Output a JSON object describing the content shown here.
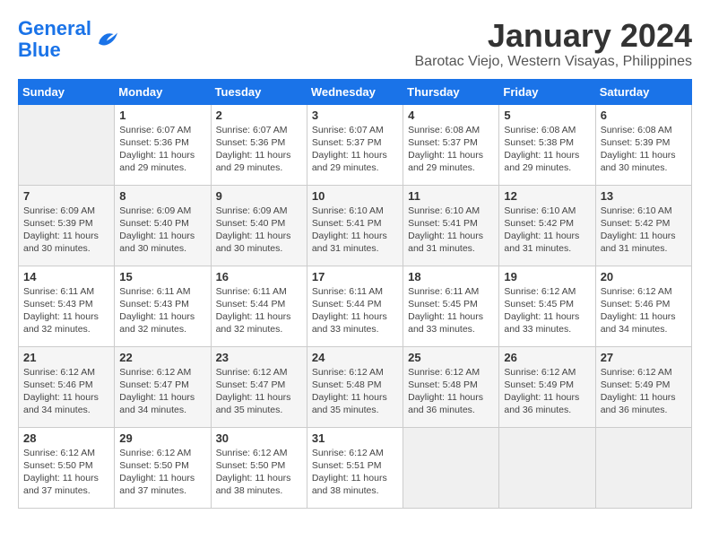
{
  "header": {
    "logo_line1": "General",
    "logo_line2": "Blue",
    "month": "January 2024",
    "location": "Barotac Viejo, Western Visayas, Philippines"
  },
  "weekdays": [
    "Sunday",
    "Monday",
    "Tuesday",
    "Wednesday",
    "Thursday",
    "Friday",
    "Saturday"
  ],
  "weeks": [
    [
      {
        "day": "",
        "sunrise": "",
        "sunset": "",
        "daylight": ""
      },
      {
        "day": "1",
        "sunrise": "Sunrise: 6:07 AM",
        "sunset": "Sunset: 5:36 PM",
        "daylight": "Daylight: 11 hours and 29 minutes."
      },
      {
        "day": "2",
        "sunrise": "Sunrise: 6:07 AM",
        "sunset": "Sunset: 5:36 PM",
        "daylight": "Daylight: 11 hours and 29 minutes."
      },
      {
        "day": "3",
        "sunrise": "Sunrise: 6:07 AM",
        "sunset": "Sunset: 5:37 PM",
        "daylight": "Daylight: 11 hours and 29 minutes."
      },
      {
        "day": "4",
        "sunrise": "Sunrise: 6:08 AM",
        "sunset": "Sunset: 5:37 PM",
        "daylight": "Daylight: 11 hours and 29 minutes."
      },
      {
        "day": "5",
        "sunrise": "Sunrise: 6:08 AM",
        "sunset": "Sunset: 5:38 PM",
        "daylight": "Daylight: 11 hours and 29 minutes."
      },
      {
        "day": "6",
        "sunrise": "Sunrise: 6:08 AM",
        "sunset": "Sunset: 5:39 PM",
        "daylight": "Daylight: 11 hours and 30 minutes."
      }
    ],
    [
      {
        "day": "7",
        "sunrise": "Sunrise: 6:09 AM",
        "sunset": "Sunset: 5:39 PM",
        "daylight": "Daylight: 11 hours and 30 minutes."
      },
      {
        "day": "8",
        "sunrise": "Sunrise: 6:09 AM",
        "sunset": "Sunset: 5:40 PM",
        "daylight": "Daylight: 11 hours and 30 minutes."
      },
      {
        "day": "9",
        "sunrise": "Sunrise: 6:09 AM",
        "sunset": "Sunset: 5:40 PM",
        "daylight": "Daylight: 11 hours and 30 minutes."
      },
      {
        "day": "10",
        "sunrise": "Sunrise: 6:10 AM",
        "sunset": "Sunset: 5:41 PM",
        "daylight": "Daylight: 11 hours and 31 minutes."
      },
      {
        "day": "11",
        "sunrise": "Sunrise: 6:10 AM",
        "sunset": "Sunset: 5:41 PM",
        "daylight": "Daylight: 11 hours and 31 minutes."
      },
      {
        "day": "12",
        "sunrise": "Sunrise: 6:10 AM",
        "sunset": "Sunset: 5:42 PM",
        "daylight": "Daylight: 11 hours and 31 minutes."
      },
      {
        "day": "13",
        "sunrise": "Sunrise: 6:10 AM",
        "sunset": "Sunset: 5:42 PM",
        "daylight": "Daylight: 11 hours and 31 minutes."
      }
    ],
    [
      {
        "day": "14",
        "sunrise": "Sunrise: 6:11 AM",
        "sunset": "Sunset: 5:43 PM",
        "daylight": "Daylight: 11 hours and 32 minutes."
      },
      {
        "day": "15",
        "sunrise": "Sunrise: 6:11 AM",
        "sunset": "Sunset: 5:43 PM",
        "daylight": "Daylight: 11 hours and 32 minutes."
      },
      {
        "day": "16",
        "sunrise": "Sunrise: 6:11 AM",
        "sunset": "Sunset: 5:44 PM",
        "daylight": "Daylight: 11 hours and 32 minutes."
      },
      {
        "day": "17",
        "sunrise": "Sunrise: 6:11 AM",
        "sunset": "Sunset: 5:44 PM",
        "daylight": "Daylight: 11 hours and 33 minutes."
      },
      {
        "day": "18",
        "sunrise": "Sunrise: 6:11 AM",
        "sunset": "Sunset: 5:45 PM",
        "daylight": "Daylight: 11 hours and 33 minutes."
      },
      {
        "day": "19",
        "sunrise": "Sunrise: 6:12 AM",
        "sunset": "Sunset: 5:45 PM",
        "daylight": "Daylight: 11 hours and 33 minutes."
      },
      {
        "day": "20",
        "sunrise": "Sunrise: 6:12 AM",
        "sunset": "Sunset: 5:46 PM",
        "daylight": "Daylight: 11 hours and 34 minutes."
      }
    ],
    [
      {
        "day": "21",
        "sunrise": "Sunrise: 6:12 AM",
        "sunset": "Sunset: 5:46 PM",
        "daylight": "Daylight: 11 hours and 34 minutes."
      },
      {
        "day": "22",
        "sunrise": "Sunrise: 6:12 AM",
        "sunset": "Sunset: 5:47 PM",
        "daylight": "Daylight: 11 hours and 34 minutes."
      },
      {
        "day": "23",
        "sunrise": "Sunrise: 6:12 AM",
        "sunset": "Sunset: 5:47 PM",
        "daylight": "Daylight: 11 hours and 35 minutes."
      },
      {
        "day": "24",
        "sunrise": "Sunrise: 6:12 AM",
        "sunset": "Sunset: 5:48 PM",
        "daylight": "Daylight: 11 hours and 35 minutes."
      },
      {
        "day": "25",
        "sunrise": "Sunrise: 6:12 AM",
        "sunset": "Sunset: 5:48 PM",
        "daylight": "Daylight: 11 hours and 36 minutes."
      },
      {
        "day": "26",
        "sunrise": "Sunrise: 6:12 AM",
        "sunset": "Sunset: 5:49 PM",
        "daylight": "Daylight: 11 hours and 36 minutes."
      },
      {
        "day": "27",
        "sunrise": "Sunrise: 6:12 AM",
        "sunset": "Sunset: 5:49 PM",
        "daylight": "Daylight: 11 hours and 36 minutes."
      }
    ],
    [
      {
        "day": "28",
        "sunrise": "Sunrise: 6:12 AM",
        "sunset": "Sunset: 5:50 PM",
        "daylight": "Daylight: 11 hours and 37 minutes."
      },
      {
        "day": "29",
        "sunrise": "Sunrise: 6:12 AM",
        "sunset": "Sunset: 5:50 PM",
        "daylight": "Daylight: 11 hours and 37 minutes."
      },
      {
        "day": "30",
        "sunrise": "Sunrise: 6:12 AM",
        "sunset": "Sunset: 5:50 PM",
        "daylight": "Daylight: 11 hours and 38 minutes."
      },
      {
        "day": "31",
        "sunrise": "Sunrise: 6:12 AM",
        "sunset": "Sunset: 5:51 PM",
        "daylight": "Daylight: 11 hours and 38 minutes."
      },
      {
        "day": "",
        "sunrise": "",
        "sunset": "",
        "daylight": ""
      },
      {
        "day": "",
        "sunrise": "",
        "sunset": "",
        "daylight": ""
      },
      {
        "day": "",
        "sunrise": "",
        "sunset": "",
        "daylight": ""
      }
    ]
  ]
}
